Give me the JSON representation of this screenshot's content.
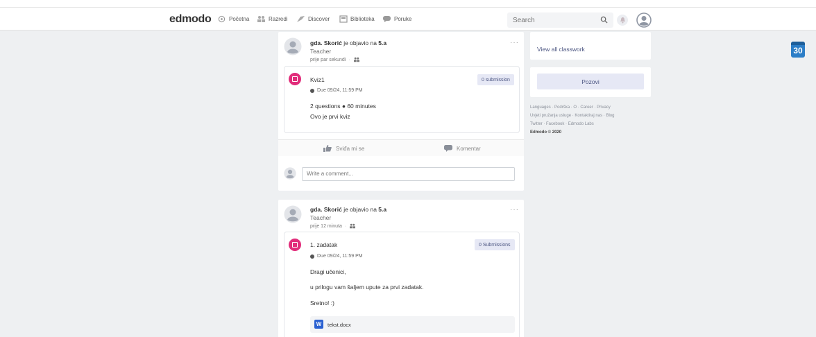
{
  "navbar": {
    "logo": "edmodo",
    "items": [
      {
        "label": "Početna",
        "icon": "home-icon"
      },
      {
        "label": "Razredi",
        "icon": "classes-icon"
      },
      {
        "label": "Discover",
        "icon": "discover-icon"
      },
      {
        "label": "Biblioteka",
        "icon": "library-icon"
      },
      {
        "label": "Poruke",
        "icon": "messages-icon"
      }
    ],
    "search_placeholder": "Search"
  },
  "posts": [
    {
      "author": "gda. Skorić",
      "verb": " je objavio na ",
      "group": "5.a",
      "role": "Teacher",
      "time": "prije par sekundi",
      "item_title": "Kviz1",
      "submissions": "0 submission",
      "due": "Due 09/24, 11:59 PM",
      "lines": [
        "2 questions ● 60 minutes",
        "Ovo je prvi kviz"
      ]
    },
    {
      "author": "gda. Skorić",
      "verb": " je objavio na ",
      "group": "5.a",
      "role": "Teacher",
      "time": "prije 12 minuta",
      "item_title": "1. zadatak",
      "submissions": "0 Submissions",
      "due": "Due 09/24, 11:59 PM",
      "lines": [
        "Dragi učenici,",
        "u prilogu vam šaljem upute za prvi zadatak.",
        "Sretno! :)"
      ],
      "attachment": "tekst.docx"
    }
  ],
  "actions": {
    "like": "Sviđa mi se",
    "comment": "Komentar"
  },
  "comment_placeholder": "Write a comment...",
  "sidebar": {
    "view_all": "View all classwork",
    "invite": "Pozovi",
    "footer_row1": [
      "Languages",
      "Podrška",
      "O",
      "Career",
      "Privacy"
    ],
    "footer_row2": [
      "Uvjeti pružanja usluge",
      "Kontaktiraj nas",
      "Blog"
    ],
    "footer_row3": [
      "Twitter",
      "Facebook",
      "Edmodo Labs"
    ],
    "copyright": "Edmodo © 2020"
  },
  "calendar": {
    "day": "30"
  },
  "colors": {
    "accent": "#e12d7b",
    "button_bg": "#e6e8f5",
    "word_blue": "#2b61d1",
    "calendar_blue": "#2c7ec7"
  }
}
